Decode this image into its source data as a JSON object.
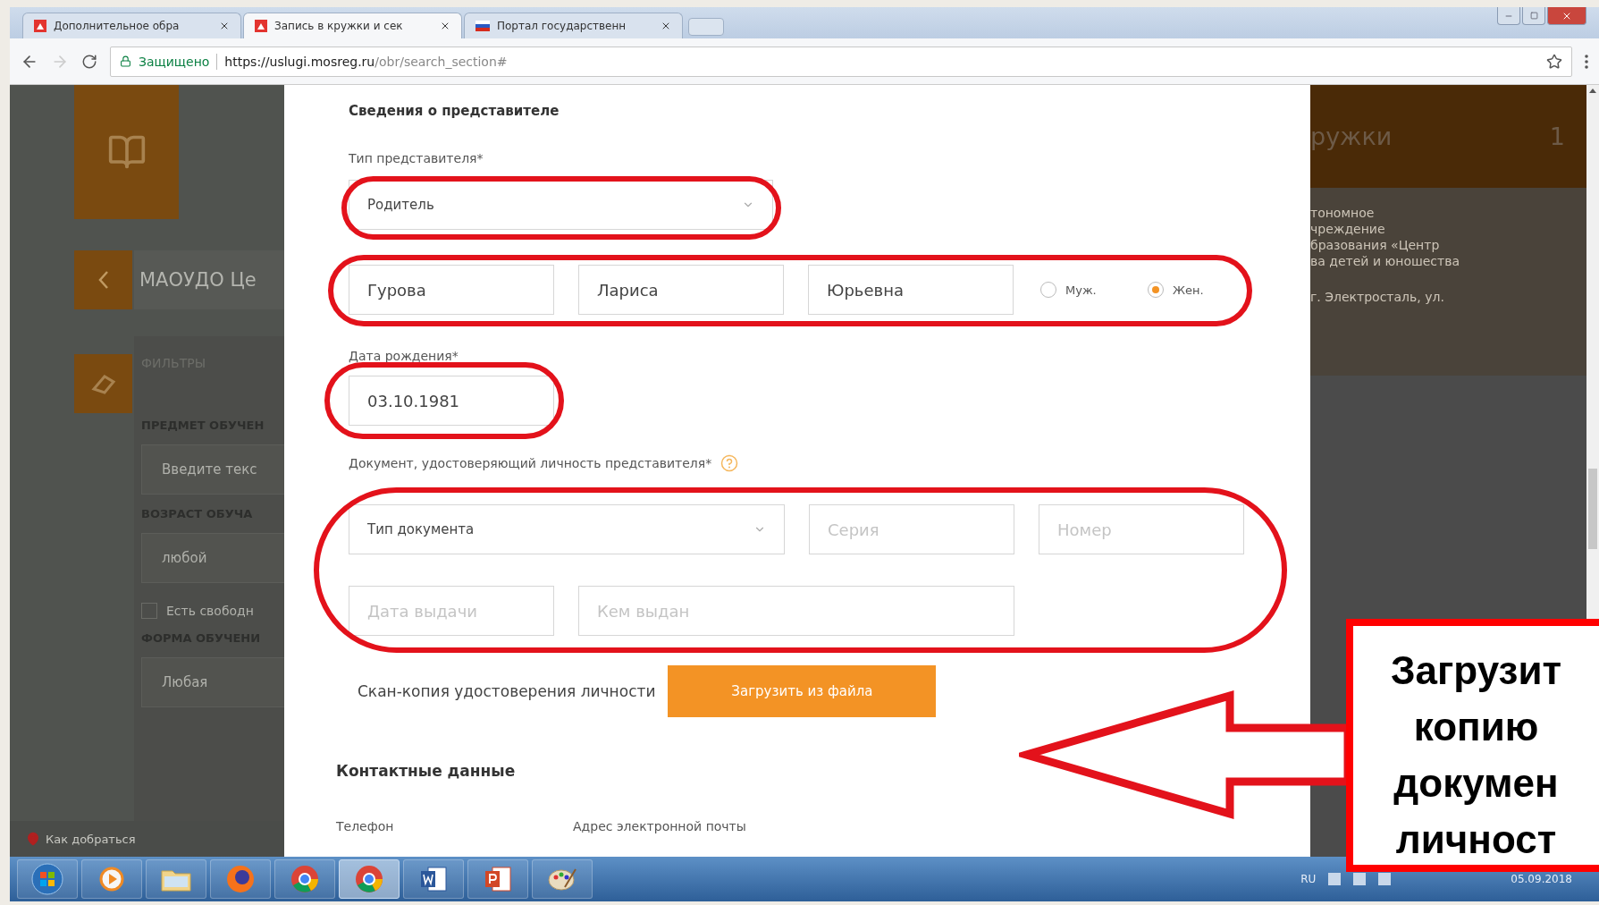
{
  "browser": {
    "tabs": [
      {
        "title": "Дополнительное обра",
        "kind": "mosreg",
        "selected": false
      },
      {
        "title": "Запись в кружки и сек",
        "kind": "mosreg",
        "selected": true
      },
      {
        "title": "Портал государственн",
        "kind": "flag",
        "selected": false
      }
    ],
    "security_label": "Защищено",
    "url_host": "https://uslugi.mosreg.ru",
    "url_path": "/obr/search_section#"
  },
  "left_panel": {
    "org_title": "МАОУДО Це",
    "filters_title": "ФИЛЬТРЫ",
    "filters": [
      {
        "kind": "label",
        "text": "ПРЕДМЕТ ОБУЧЕН"
      },
      {
        "kind": "field",
        "placeholder": "Введите текс"
      },
      {
        "kind": "label",
        "text": "ВОЗРАСТ ОБУЧА"
      },
      {
        "kind": "select",
        "value": "любой"
      },
      {
        "kind": "checkbox",
        "text": "Есть свободн",
        "checked": false
      },
      {
        "kind": "label",
        "text": "ФОРМА ОБУЧЕНИ"
      },
      {
        "kind": "select",
        "value": "Любая"
      }
    ],
    "map_link": "Как добраться"
  },
  "right_panel": {
    "header": "ружки",
    "count": "1",
    "description_lines": [
      "тономное",
      "чреждение",
      "бразования «Центр",
      "ва детей и юношества"
    ],
    "address": "г. Электросталь, ул."
  },
  "form": {
    "section_title": "Сведения о представителе",
    "type_label": "Тип представителя*",
    "type_value": "Родитель",
    "name_fields": [
      {
        "value": "Гурова"
      },
      {
        "value": "Лариса"
      },
      {
        "value": "Юрьевна"
      }
    ],
    "gender_options": [
      {
        "label": "Муж.",
        "selected": false
      },
      {
        "label": "Жен.",
        "selected": true
      }
    ],
    "birth_label": "Дата рождения*",
    "birth_value": "03.10.1981",
    "document_label": "Документ, удостоверяющий личность представителя*",
    "document_rows": [
      [
        {
          "kind": "select",
          "placeholder": "Тип документа"
        },
        {
          "kind": "field",
          "placeholder": "Серия"
        },
        {
          "kind": "field",
          "placeholder": "Номер"
        }
      ],
      [
        {
          "kind": "field",
          "placeholder": "Дата выдачи"
        },
        {
          "kind": "wide",
          "placeholder": "Кем выдан"
        }
      ]
    ],
    "scan_label": "Скан-копия удостоверения личности",
    "upload_button": "Загрузить из файла",
    "contacts_title": "Контактные данные",
    "phone_label": "Телефон",
    "email_label": "Адрес электронной почты"
  },
  "taskbar": {
    "apps": [
      {
        "kind": "start",
        "active": false
      },
      {
        "kind": "media",
        "active": false
      },
      {
        "kind": "folder",
        "active": false
      },
      {
        "kind": "firefox",
        "active": false
      },
      {
        "kind": "chrome",
        "active": false
      },
      {
        "kind": "chrome",
        "active": true
      },
      {
        "kind": "word",
        "active": false
      },
      {
        "kind": "powerpoint",
        "active": false
      },
      {
        "kind": "paint",
        "active": false
      }
    ],
    "language": "RU",
    "date": "05.09.2018"
  },
  "annotation": {
    "callout_lines": [
      "Загрузит",
      "копию",
      "докумен",
      "личност"
    ]
  }
}
